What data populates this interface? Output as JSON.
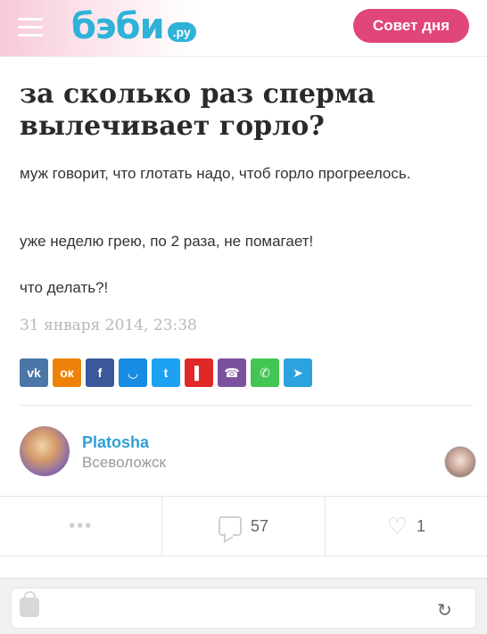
{
  "header": {
    "logo_main": "бэби",
    "logo_suffix": ".ру",
    "advice_button": "Совет дня"
  },
  "post": {
    "title": "за сколько раз сперма вылечивает горло?",
    "paragraphs": [
      "муж говорит, что глотать надо, чтоб горло прогреелось.",
      "уже неделю грею, по 2 раза, не помагает!",
      "что делать?!"
    ],
    "date": "31 января 2014, 23:38"
  },
  "share": {
    "buttons": [
      {
        "name": "vk",
        "label": "vk",
        "color": "#4a76a8"
      },
      {
        "name": "ok",
        "label": "ок",
        "color": "#ee8208"
      },
      {
        "name": "facebook",
        "label": "f",
        "color": "#3b5998"
      },
      {
        "name": "moimir",
        "label": "◡",
        "color": "#168de2"
      },
      {
        "name": "twitter",
        "label": "t",
        "color": "#1da1f2"
      },
      {
        "name": "flipboard",
        "label": "▌",
        "color": "#e12828"
      },
      {
        "name": "viber",
        "label": "☎",
        "color": "#7b519d"
      },
      {
        "name": "whatsapp",
        "label": "✆",
        "color": "#43c553"
      },
      {
        "name": "telegram",
        "label": "➤",
        "color": "#2aa3df"
      }
    ]
  },
  "author": {
    "name": "Platosha",
    "city": "Всеволожск"
  },
  "stats": {
    "comments": "57",
    "likes": "1"
  }
}
